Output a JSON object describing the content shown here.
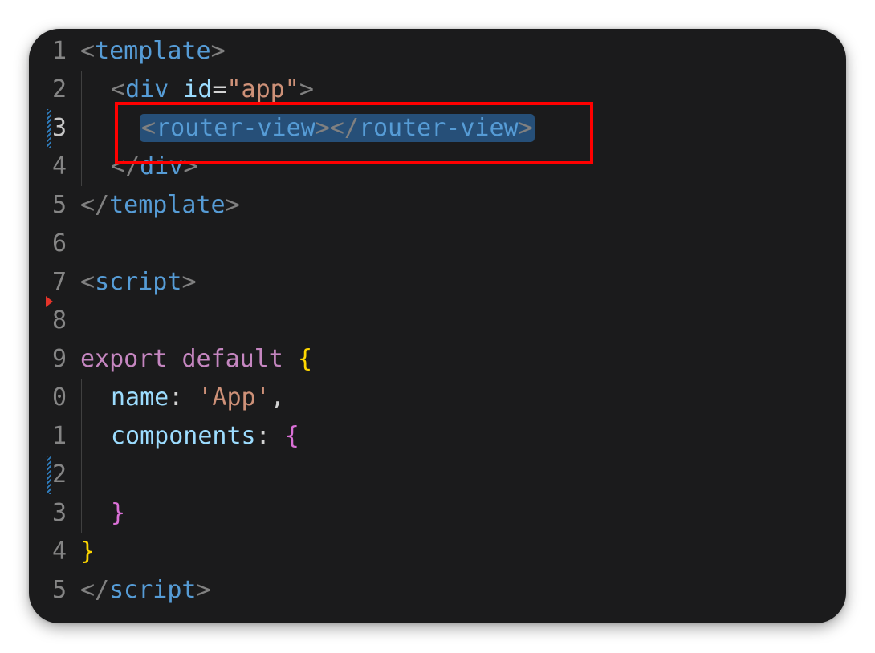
{
  "editor": {
    "line_numbers": [
      "1",
      "2",
      "3",
      "4",
      "5",
      "6",
      "7",
      "8",
      "9",
      "0",
      "1",
      "2",
      "3",
      "4",
      "5"
    ],
    "active_line_index": 2,
    "lines": [
      {
        "tokens": [
          {
            "t": "<",
            "c": "tg"
          },
          {
            "t": "template",
            "c": "tn"
          },
          {
            "t": ">",
            "c": "tg"
          }
        ]
      },
      {
        "tokens": [
          {
            "t": "<",
            "c": "tg"
          },
          {
            "t": "div",
            "c": "tn"
          },
          {
            "t": " ",
            "c": "pn"
          },
          {
            "t": "id",
            "c": "an"
          },
          {
            "t": "=",
            "c": "pn"
          },
          {
            "t": "\"app\"",
            "c": "av"
          },
          {
            "t": ">",
            "c": "tg"
          }
        ]
      },
      {
        "selected": true,
        "tokens": [
          {
            "t": "<",
            "c": "tg"
          },
          {
            "t": "router-view",
            "c": "tn"
          },
          {
            "t": "></",
            "c": "tg"
          },
          {
            "t": "router-view",
            "c": "tn"
          },
          {
            "t": ">",
            "c": "tg"
          }
        ]
      },
      {
        "tokens": [
          {
            "t": "</",
            "c": "tg"
          },
          {
            "t": "div",
            "c": "tn"
          },
          {
            "t": ">",
            "c": "tg"
          }
        ]
      },
      {
        "tokens": [
          {
            "t": "</",
            "c": "tg"
          },
          {
            "t": "template",
            "c": "tn"
          },
          {
            "t": ">",
            "c": "tg"
          }
        ]
      },
      {
        "tokens": []
      },
      {
        "tokens": [
          {
            "t": "<",
            "c": "tg"
          },
          {
            "t": "script",
            "c": "tn"
          },
          {
            "t": ">",
            "c": "tg"
          }
        ]
      },
      {
        "tokens": []
      },
      {
        "tokens": [
          {
            "t": "export",
            "c": "kw"
          },
          {
            "t": " ",
            "c": "pn"
          },
          {
            "t": "default",
            "c": "kw"
          },
          {
            "t": " ",
            "c": "pn"
          },
          {
            "t": "{",
            "c": "br-y"
          }
        ]
      },
      {
        "tokens": [
          {
            "t": "name",
            "c": "prop"
          },
          {
            "t": ": ",
            "c": "pn"
          },
          {
            "t": "'App'",
            "c": "str"
          },
          {
            "t": ",",
            "c": "pn"
          }
        ]
      },
      {
        "tokens": [
          {
            "t": "components",
            "c": "prop"
          },
          {
            "t": ": ",
            "c": "pn"
          },
          {
            "t": "{",
            "c": "br-p"
          }
        ]
      },
      {
        "tokens": []
      },
      {
        "tokens": [
          {
            "t": "}",
            "c": "br-p"
          }
        ]
      },
      {
        "tokens": [
          {
            "t": "}",
            "c": "br-y"
          }
        ]
      },
      {
        "tokens": [
          {
            "t": "</",
            "c": "tg"
          },
          {
            "t": "script",
            "c": "tn"
          },
          {
            "t": ">",
            "c": "tg"
          }
        ]
      }
    ]
  },
  "colors": {
    "background": "#1b1b1c",
    "selection": "#264f78",
    "highlight_box": "#ff0000",
    "modified_indicator": "#2f7ab8",
    "breakpoint_arrow": "#e5342a"
  }
}
